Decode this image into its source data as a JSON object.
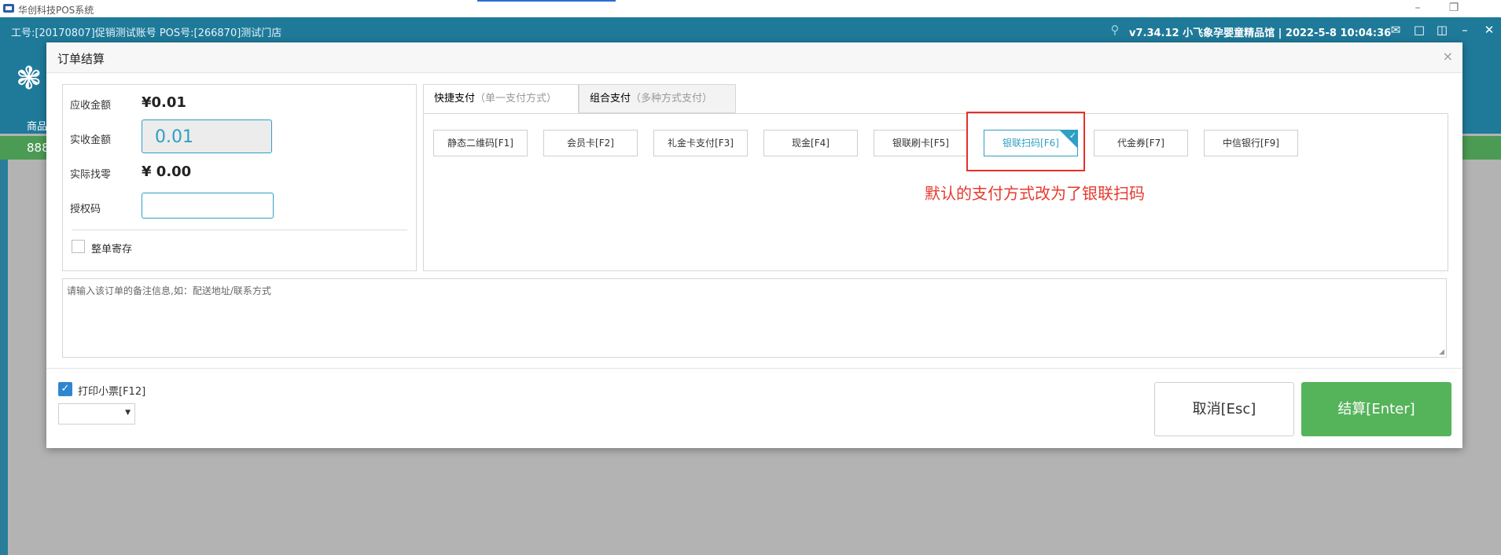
{
  "os_window": {
    "title": "华创科技POS系统",
    "minimize": "–",
    "restore": "❐"
  },
  "header": {
    "info_left": "工号:[20170807]促销测试账号   POS号:[266870]测试门店",
    "info_right": "v7.34.12  小飞象孕婴童精品馆 | 2022-5-8 10:04:36",
    "nav_label": "商品",
    "code_prefix": "888",
    "icons": [
      "search-icon",
      "mail-icon",
      "window-icon",
      "split-window-icon",
      "minimize-icon",
      "close-icon"
    ]
  },
  "modal": {
    "title": "订单结算",
    "close": "×",
    "amounts": {
      "receivable_label": "应收金额",
      "receivable_value": "¥0.01",
      "paid_label": "实收金额",
      "paid_value": "0.01",
      "change_label": "实际找零",
      "change_value": "¥ 0.00",
      "auth_label": "授权码",
      "auth_value": ""
    },
    "hold_order_label": "整单寄存",
    "tabs": [
      {
        "label": "快捷支付",
        "sub": "（单一支付方式）",
        "active": true
      },
      {
        "label": "组合支付",
        "sub": "（多种方式支付）",
        "active": false
      }
    ],
    "payment_methods": [
      {
        "label": "静态二维码[F1]",
        "selected": false
      },
      {
        "label": "会员卡[F2]",
        "selected": false
      },
      {
        "label": "礼金卡支付[F3]",
        "selected": false
      },
      {
        "label": "现金[F4]",
        "selected": false
      },
      {
        "label": "银联刷卡[F5]",
        "selected": false
      },
      {
        "label": "银联扫码[F6]",
        "selected": true
      },
      {
        "label": "代金券[F7]",
        "selected": false
      },
      {
        "label": "中信银行[F9]",
        "selected": false
      }
    ],
    "annotation": "默认的支付方式改为了银联扫码",
    "memo_placeholder": "请输入该订单的备注信息,如：配送地址/联系方式",
    "print_label": "打印小票[F12]",
    "print_checked": true,
    "printer_selected": "",
    "cancel_label": "取消[Esc]",
    "settle_label": "结算[Enter]"
  },
  "colors": {
    "header_bg": "#1f7a9a",
    "accent": "#2f9fc4",
    "settle_green": "#55b35a",
    "annotation_red": "#e53a2f"
  }
}
